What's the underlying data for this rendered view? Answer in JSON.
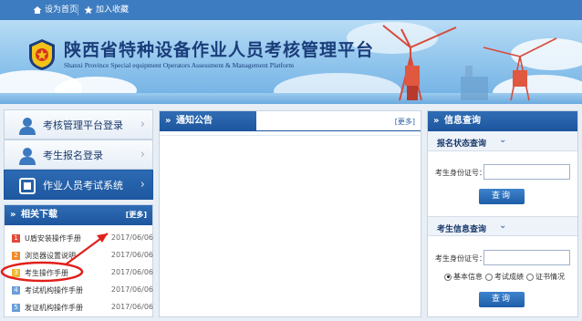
{
  "topbar": {
    "set_home": "设为首页",
    "bookmark": "加入收藏"
  },
  "banner": {
    "title_cn": "陕西省特种设备作业人员考核管理平台",
    "title_en": "Shanxi Province Special equipment Operators Assessment & Management Platform"
  },
  "left_nav": {
    "items": [
      {
        "label": "考核管理平台登录"
      },
      {
        "label": "考生报名登录"
      },
      {
        "label": "作业人员考试系统"
      }
    ]
  },
  "downloads": {
    "title": "相关下载",
    "more": "[更多]",
    "items": [
      {
        "num": "1",
        "name": "U盾安装操作手册",
        "date": "2017/06/06",
        "color": "#e04b3a"
      },
      {
        "num": "2",
        "name": "浏览器设置说明",
        "date": "2017/06/06",
        "color": "#f08a2a"
      },
      {
        "num": "3",
        "name": "考生操作手册",
        "date": "2017/06/06",
        "color": "#f0b830"
      },
      {
        "num": "4",
        "name": "考试机构操作手册",
        "date": "2017/06/06",
        "color": "#6a9fd8"
      },
      {
        "num": "5",
        "name": "发证机构操作手册",
        "date": "2017/06/06",
        "color": "#6a9fd8"
      }
    ]
  },
  "notice": {
    "title": "通知公告",
    "more": "[更多]"
  },
  "info_query": {
    "title": "信息查询",
    "status_section": {
      "title": "报名状态查询",
      "id_label": "考生身份证号：",
      "id_value": "",
      "button": "查询"
    },
    "info_section": {
      "title": "考生信息查询",
      "id_label": "考生身份证号：",
      "id_value": "",
      "options": [
        "基本信息",
        "考试成绩",
        "证书情况"
      ],
      "selected": "基本信息",
      "button": "查询"
    }
  },
  "colors": {
    "accent": "#1e58a0",
    "highlight_ring": "#e0201a"
  }
}
